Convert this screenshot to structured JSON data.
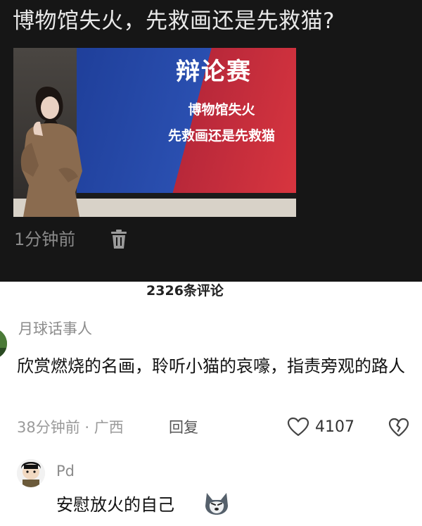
{
  "post": {
    "title": "博物馆失火，先救画还是先救猫?",
    "video": {
      "slide_title": "辩论赛",
      "slide_line1": "博物馆失火",
      "slide_line2": "先救画还是先救猫"
    },
    "time": "1分钟前",
    "delete_icon": "trash-icon"
  },
  "comments_count": "2326条评论",
  "comments": [
    {
      "user": "月球话事人",
      "text": "欣赏燃烧的名画，聆听小猫的哀嚎，指责旁观的路人",
      "meta": "38分钟前 · 广西",
      "reply_label": "回复",
      "likes": "4107",
      "like_icon": "heart-outline-icon",
      "dislike_icon": "broken-heart-icon"
    },
    {
      "user": "Pd",
      "text": "安慰放火的自己",
      "emoji_icon": "husky-dog-emoji-icon"
    }
  ]
}
